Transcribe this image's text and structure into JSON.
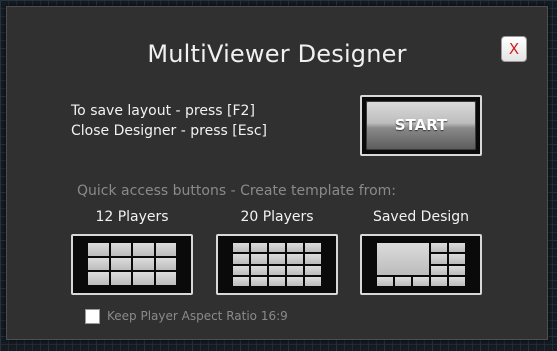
{
  "dialog": {
    "title": "MultiViewer Designer",
    "close_label": "X"
  },
  "instructions": {
    "save_line": "To save layout - press [F2]",
    "close_line": "Close Designer - press [Esc]"
  },
  "start_button": {
    "label": "START"
  },
  "quick_access": {
    "label": "Quick access buttons - Create template from:",
    "templates": [
      {
        "label": "12 Players",
        "icon": "grid-4x3-icon"
      },
      {
        "label": "20 Players",
        "icon": "grid-5x4-icon"
      },
      {
        "label": "Saved Design",
        "icon": "saved-layout-icon"
      }
    ]
  },
  "aspect_ratio": {
    "label": "Keep Player Aspect Ratio 16:9",
    "checked": false
  },
  "colors": {
    "dialog_bg": "#303030",
    "close_x": "#d22020",
    "muted_text": "#8a8a8a"
  }
}
